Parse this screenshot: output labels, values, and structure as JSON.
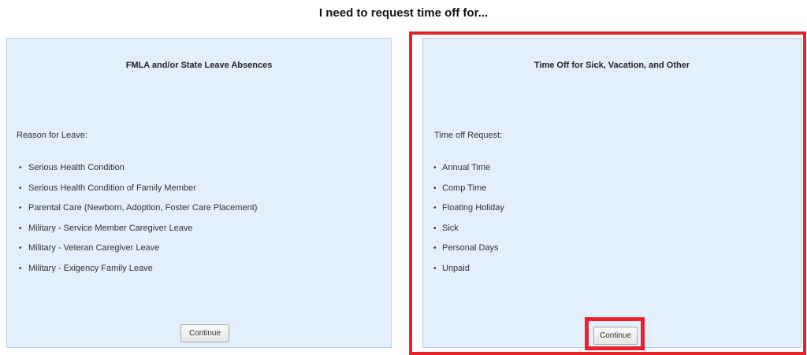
{
  "heading": "I need to request time off for...",
  "panels": {
    "fmla": {
      "title": "FMLA and/or State Leave Absences",
      "subheading": "Reason for Leave:",
      "items": [
        "Serious Health Condition",
        "Serious Health Condition of Family Member",
        "Parental Care (Newborn, Adoption, Foster Care Placement)",
        "Military - Service Member Caregiver Leave",
        "Military - Veteran Caregiver Leave",
        "Military - Exigency Family Leave"
      ],
      "button_label": "Continue"
    },
    "timeoff": {
      "title": "Time Off for Sick, Vacation, and Other",
      "subheading": "Time off Request:",
      "items": [
        "Annual Time",
        "Comp Time",
        "Floating Holiday",
        "Sick",
        "Personal Days",
        "Unpaid"
      ],
      "button_label": "Continue"
    }
  },
  "bullet": "•",
  "colors": {
    "panel_background": "#e3effd",
    "panel_border": "#b9cde3",
    "highlight": "#e8212a"
  }
}
